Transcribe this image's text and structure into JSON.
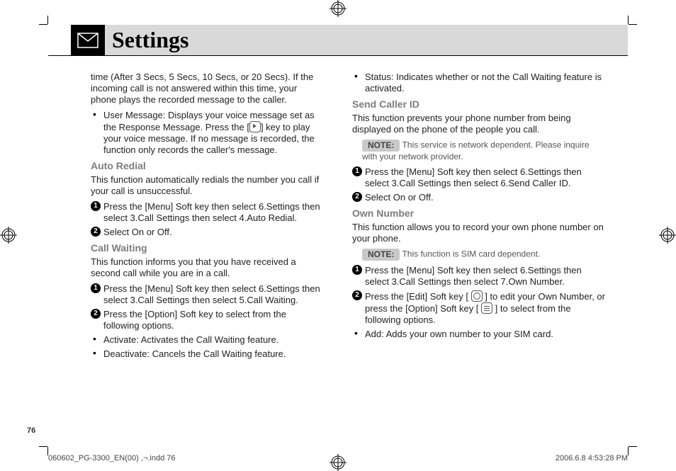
{
  "header": {
    "title": "Settings"
  },
  "page_number": "76",
  "footer": {
    "file": "060602_PG-3300_EN(00) ,¬.indd   76",
    "timestamp": "2006.6.8   4:53:28 PM"
  },
  "left": {
    "p1_part": "time (After 3 Secs, 5 Secs, 10 Secs, or 20 Secs). If the incoming call is not answered within this time, your phone plays the recorded message to the caller.",
    "p2_a": "User Message: Displays your voice message set as the Response Message. Press the [",
    "p2_b": "] key to play your voice message. If no message is recorded, the function only records the caller's message.",
    "h_auto": "Auto Redial",
    "auto_desc": "This function automatically redials the number you call if your call is unsuccessful.",
    "auto_s1": "Press the [Menu] Soft key then select 6.Settings then select 3.Call Settings then select 4.Auto Redial.",
    "auto_s2": "Select On or Off.",
    "h_cw": "Call Waiting",
    "cw_desc": "This function informs you that you have received a second call while you are in a call.",
    "cw_s1": "Press the [Menu] Soft key then select 6.Settings then select 3.Call Settings then select 5.Call Waiting.",
    "cw_s2": "Press the [Option] Soft key to select from the following options.",
    "cw_b1": "Activate: Activates the Call Waiting feature.",
    "cw_b2": "Deactivate: Cancels the Call Waiting feature."
  },
  "right": {
    "cw_b3": "Status: Indicates whether or not the Call Waiting feature is activated.",
    "h_scid": "Send Caller ID",
    "scid_desc": "This function prevents your phone number from being displayed on the phone of the people you call.",
    "note_label": "NOTE:",
    "scid_note": "This service is network dependent. Please inquire with your network provider.",
    "scid_s1": "Press the [Menu] Soft key then select 6.Settings then select 3.Call Settings then select 6.Send Caller ID.",
    "scid_s2": "Select On or Off.",
    "h_own": "Own Number",
    "own_desc": "This function allows you to record your own phone number on your phone.",
    "own_note": "This function is SIM card dependent.",
    "own_s1": "Press the [Menu] Soft key then select 6.Settings then select 3.Call Settings then select 7.Own Number.",
    "own_s2_a": "Press the [Edit] Soft key [ ",
    "own_s2_b": " ] to edit your Own Number, or press the [Option] Soft key [ ",
    "own_s2_c": " ] to select from the following options.",
    "own_b1": "Add: Adds your own number to your SIM card."
  }
}
